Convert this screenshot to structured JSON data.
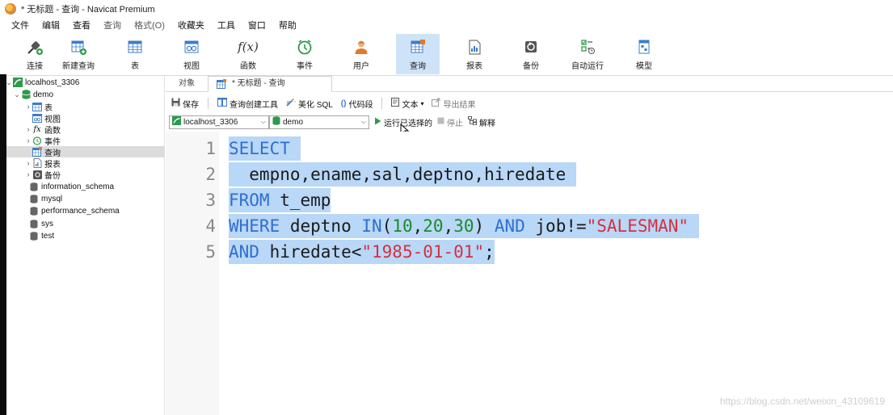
{
  "window": {
    "title": "* 无标题 - 查询 - Navicat Premium"
  },
  "menu": [
    "文件",
    "编辑",
    "查看",
    "查询",
    "格式(O)",
    "收藏夹",
    "工具",
    "窗口",
    "帮助"
  ],
  "toolbar": {
    "items": [
      {
        "label": "连接",
        "icon": "plug-icon"
      },
      {
        "label": "新建查询",
        "icon": "new-query-icon"
      },
      {
        "label": "表",
        "icon": "table-icon"
      },
      {
        "label": "视图",
        "icon": "view-icon"
      },
      {
        "label": "函数",
        "icon": "function-icon",
        "glyph": "f(x)"
      },
      {
        "label": "事件",
        "icon": "clock-icon"
      },
      {
        "label": "用户",
        "icon": "user-icon"
      },
      {
        "label": "查询",
        "icon": "query-icon"
      },
      {
        "label": "报表",
        "icon": "report-icon"
      },
      {
        "label": "备份",
        "icon": "backup-icon"
      },
      {
        "label": "自动运行",
        "icon": "auto-run-icon"
      },
      {
        "label": "模型",
        "icon": "model-icon"
      }
    ],
    "active": "查询"
  },
  "sidebar": {
    "connection": "localhost_3306",
    "database": "demo",
    "demo_children": [
      "表",
      "视图",
      "函数",
      "事件",
      "查询",
      "报表",
      "备份"
    ],
    "function_glyph": "fx",
    "selected": "查询",
    "other_databases": [
      "information_schema",
      "mysql",
      "performance_schema",
      "sys",
      "test"
    ]
  },
  "tabs": {
    "objects": "对象",
    "query": "* 无标题 - 查询"
  },
  "query_toolbar": {
    "save": "保存",
    "builder": "查询创建工具",
    "beautify": "美化 SQL",
    "snippet": "代码段",
    "snippet_glyph": "()",
    "text": "文本",
    "text_arrow": "▾",
    "export": "导出结果"
  },
  "selectors": {
    "connection": "localhost_3306",
    "database": "demo",
    "run_selected": "运行已选择的",
    "stop": "停止",
    "explain": "解释"
  },
  "editor": {
    "line_numbers": [
      "1",
      "2",
      "3",
      "4",
      "5"
    ],
    "line1": {
      "kw": "SELECT",
      "trail": " "
    },
    "line2": {
      "text": "  empno,ename,sal,deptno,hiredate "
    },
    "line3": {
      "kw": "FROM",
      "rest": " t_emp"
    },
    "line4": {
      "kw1": "WHERE",
      "a": " deptno ",
      "kw2": "IN",
      "p1": "(",
      "n1": "10",
      "c1": ",",
      "n2": "20",
      "c2": ",",
      "n3": "30",
      "p2": ") ",
      "kw3": "AND",
      "b": " job!=",
      "s": "\"SALESMAN\"",
      "trail": " "
    },
    "line5": {
      "kw": "AND",
      "a": " hiredate<",
      "s": "\"1985-01-01\"",
      "end": ";"
    }
  },
  "watermark": "https://blog.csdn.net/weixin_43109619",
  "colors": {
    "keyword": "#2f6fd0",
    "number": "#1b8a28",
    "string": "#d6303f",
    "selection": "#b9d7f6",
    "active_tool": "#cfe3f8"
  }
}
